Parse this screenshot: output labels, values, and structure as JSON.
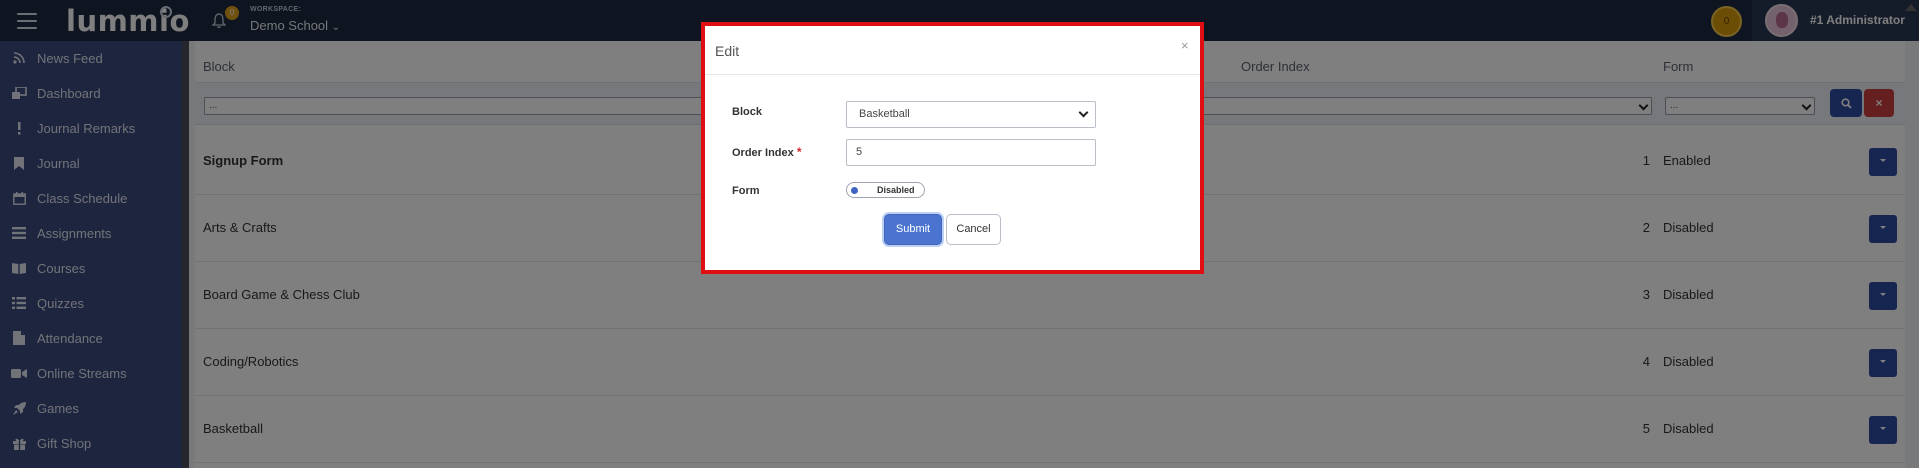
{
  "topbar": {
    "logo": "lummio",
    "notification_count": "0",
    "workspace_label": "WORKSPACE:",
    "workspace_name": "Demo School",
    "coin_count": "0",
    "user_name": "#1 Administrator"
  },
  "sidebar": {
    "items": [
      {
        "label": "News Feed",
        "icon": "rss-icon"
      },
      {
        "label": "Dashboard",
        "icon": "dashboard-icon"
      },
      {
        "label": "Journal Remarks",
        "icon": "exclamation-icon"
      },
      {
        "label": "Journal",
        "icon": "bookmark-icon"
      },
      {
        "label": "Class Schedule",
        "icon": "calendar-icon"
      },
      {
        "label": "Assignments",
        "icon": "list-icon"
      },
      {
        "label": "Courses",
        "icon": "book-icon"
      },
      {
        "label": "Quizzes",
        "icon": "quiz-icon"
      },
      {
        "label": "Attendance",
        "icon": "file-icon"
      },
      {
        "label": "Online Streams",
        "icon": "video-icon"
      },
      {
        "label": "Games",
        "icon": "rocket-icon"
      },
      {
        "label": "Gift Shop",
        "icon": "gift-icon"
      }
    ]
  },
  "table": {
    "headers": {
      "block": "Block",
      "order_index": "Order Index",
      "form": "Form"
    },
    "filters": {
      "block": "...",
      "order_index": "",
      "form": "..."
    },
    "rows": [
      {
        "block": "Signup Form",
        "order": "1",
        "form": "Enabled"
      },
      {
        "block": "Arts & Crafts",
        "order": "2",
        "form": "Disabled"
      },
      {
        "block": "Board Game & Chess Club",
        "order": "3",
        "form": "Disabled"
      },
      {
        "block": "Coding/Robotics",
        "order": "4",
        "form": "Disabled"
      },
      {
        "block": "Basketball",
        "order": "5",
        "form": "Disabled"
      }
    ]
  },
  "modal": {
    "title": "Edit",
    "close": "×",
    "block_label": "Block",
    "block_value": "Basketball",
    "order_label": "Order Index",
    "required_mark": "*",
    "order_value": "5",
    "form_label": "Form",
    "form_toggle": "Disabled",
    "submit": "Submit",
    "cancel": "Cancel"
  },
  "colors": {
    "topbar": "#1f2b41",
    "sidebar": "#3b4b7f",
    "primary": "#2f4da0",
    "danger": "#cc3f3f",
    "highlight_border": "#e00d12"
  }
}
